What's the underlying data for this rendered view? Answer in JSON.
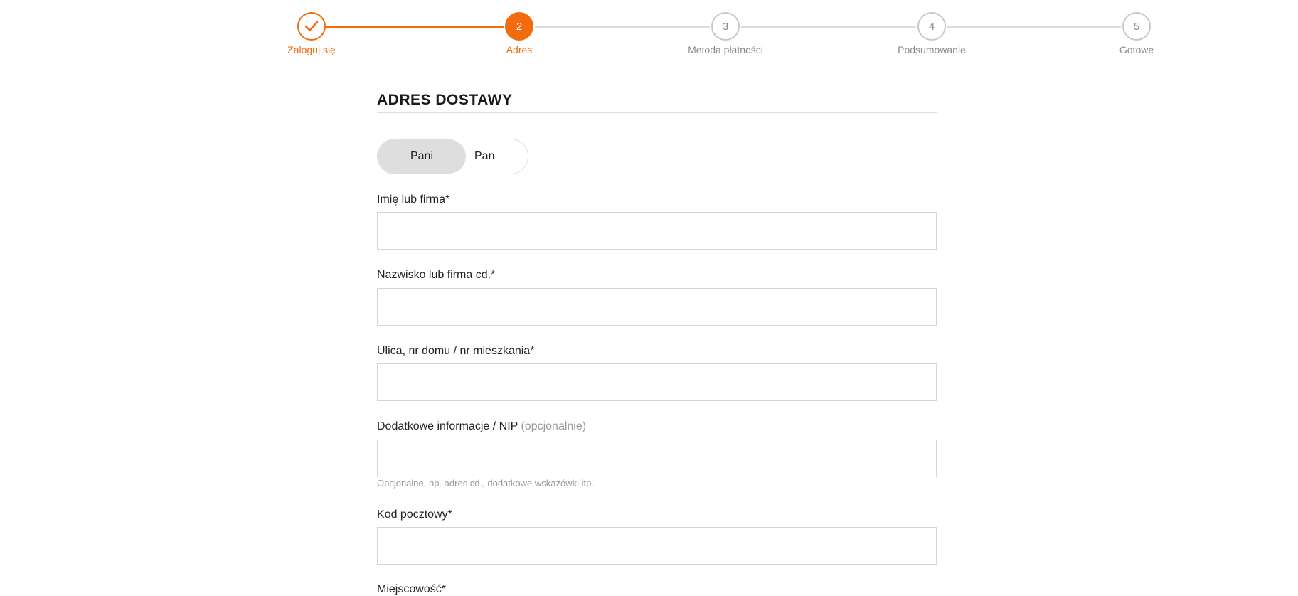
{
  "stepper": {
    "steps": [
      {
        "number": "",
        "label": "Zaloguj się",
        "state": "done",
        "icon": "checkmark-icon"
      },
      {
        "number": "2",
        "label": "Adres",
        "state": "active"
      },
      {
        "number": "3",
        "label": "Metoda płatności",
        "state": "pending"
      },
      {
        "number": "4",
        "label": "Podsumowanie",
        "state": "pending"
      },
      {
        "number": "5",
        "label": "Gotowe",
        "state": "pending"
      }
    ],
    "colors": {
      "accent": "#f26b0f",
      "inactive": "#c8c8c8",
      "line": "#dcdcdc"
    }
  },
  "form": {
    "title": "ADRES DOSTAWY",
    "salutation": {
      "options": [
        "Pani",
        "Pan"
      ],
      "selected": "Pani"
    },
    "fields": [
      {
        "label": "Imię lub firma*",
        "value": "",
        "placeholder": ""
      },
      {
        "label": "Nazwisko lub firma cd.*",
        "value": "",
        "placeholder": ""
      },
      {
        "label": "Ulica, nr domu / nr mieszkania*",
        "value": "",
        "placeholder": ""
      },
      {
        "label": "Dodatkowe informacje / NIP",
        "optional": "(opcjonalnie)",
        "value": "",
        "placeholder": "",
        "help": "Opcjonalne, np. adres cd., dodatkowe wskazówki itp."
      },
      {
        "label": "Kod pocztowy*",
        "value": "",
        "placeholder": ""
      },
      {
        "label": "Miejscowość*",
        "value": "",
        "placeholder": ""
      }
    ]
  }
}
